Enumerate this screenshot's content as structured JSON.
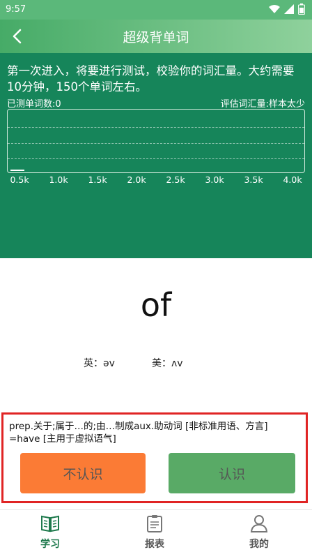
{
  "status": {
    "time": "9:57"
  },
  "header": {
    "title": "超级背单词"
  },
  "test": {
    "intro": "第一次进入，将要进行测试，校验你的词汇量。大约需要10分钟，150个单词左右。",
    "tested_label": "已测单词数:0",
    "estimate_label": "评估词汇量:样本太少"
  },
  "chart_data": {
    "type": "bar",
    "categories": [
      "0.5k",
      "1.0k",
      "1.5k",
      "2.0k",
      "2.5k",
      "3.0k",
      "3.5k",
      "4.0k"
    ],
    "values": [
      0,
      0,
      0,
      0,
      0,
      0,
      0,
      0
    ],
    "grid": true
  },
  "word": {
    "text": "of",
    "uk": "英：əv",
    "us": "美：ʌv"
  },
  "answer": {
    "meaning": "prep.关于;属于…的;由…制成aux.助动词 [非标准用语、方言] =have [主用于虚拟语气]",
    "unknown_label": "不认识",
    "known_label": "认识"
  },
  "nav": {
    "items": [
      {
        "label": "学习",
        "color": "#1f7a4d"
      },
      {
        "label": "报表",
        "color": "#555555"
      },
      {
        "label": "我的",
        "color": "#555555"
      }
    ]
  }
}
